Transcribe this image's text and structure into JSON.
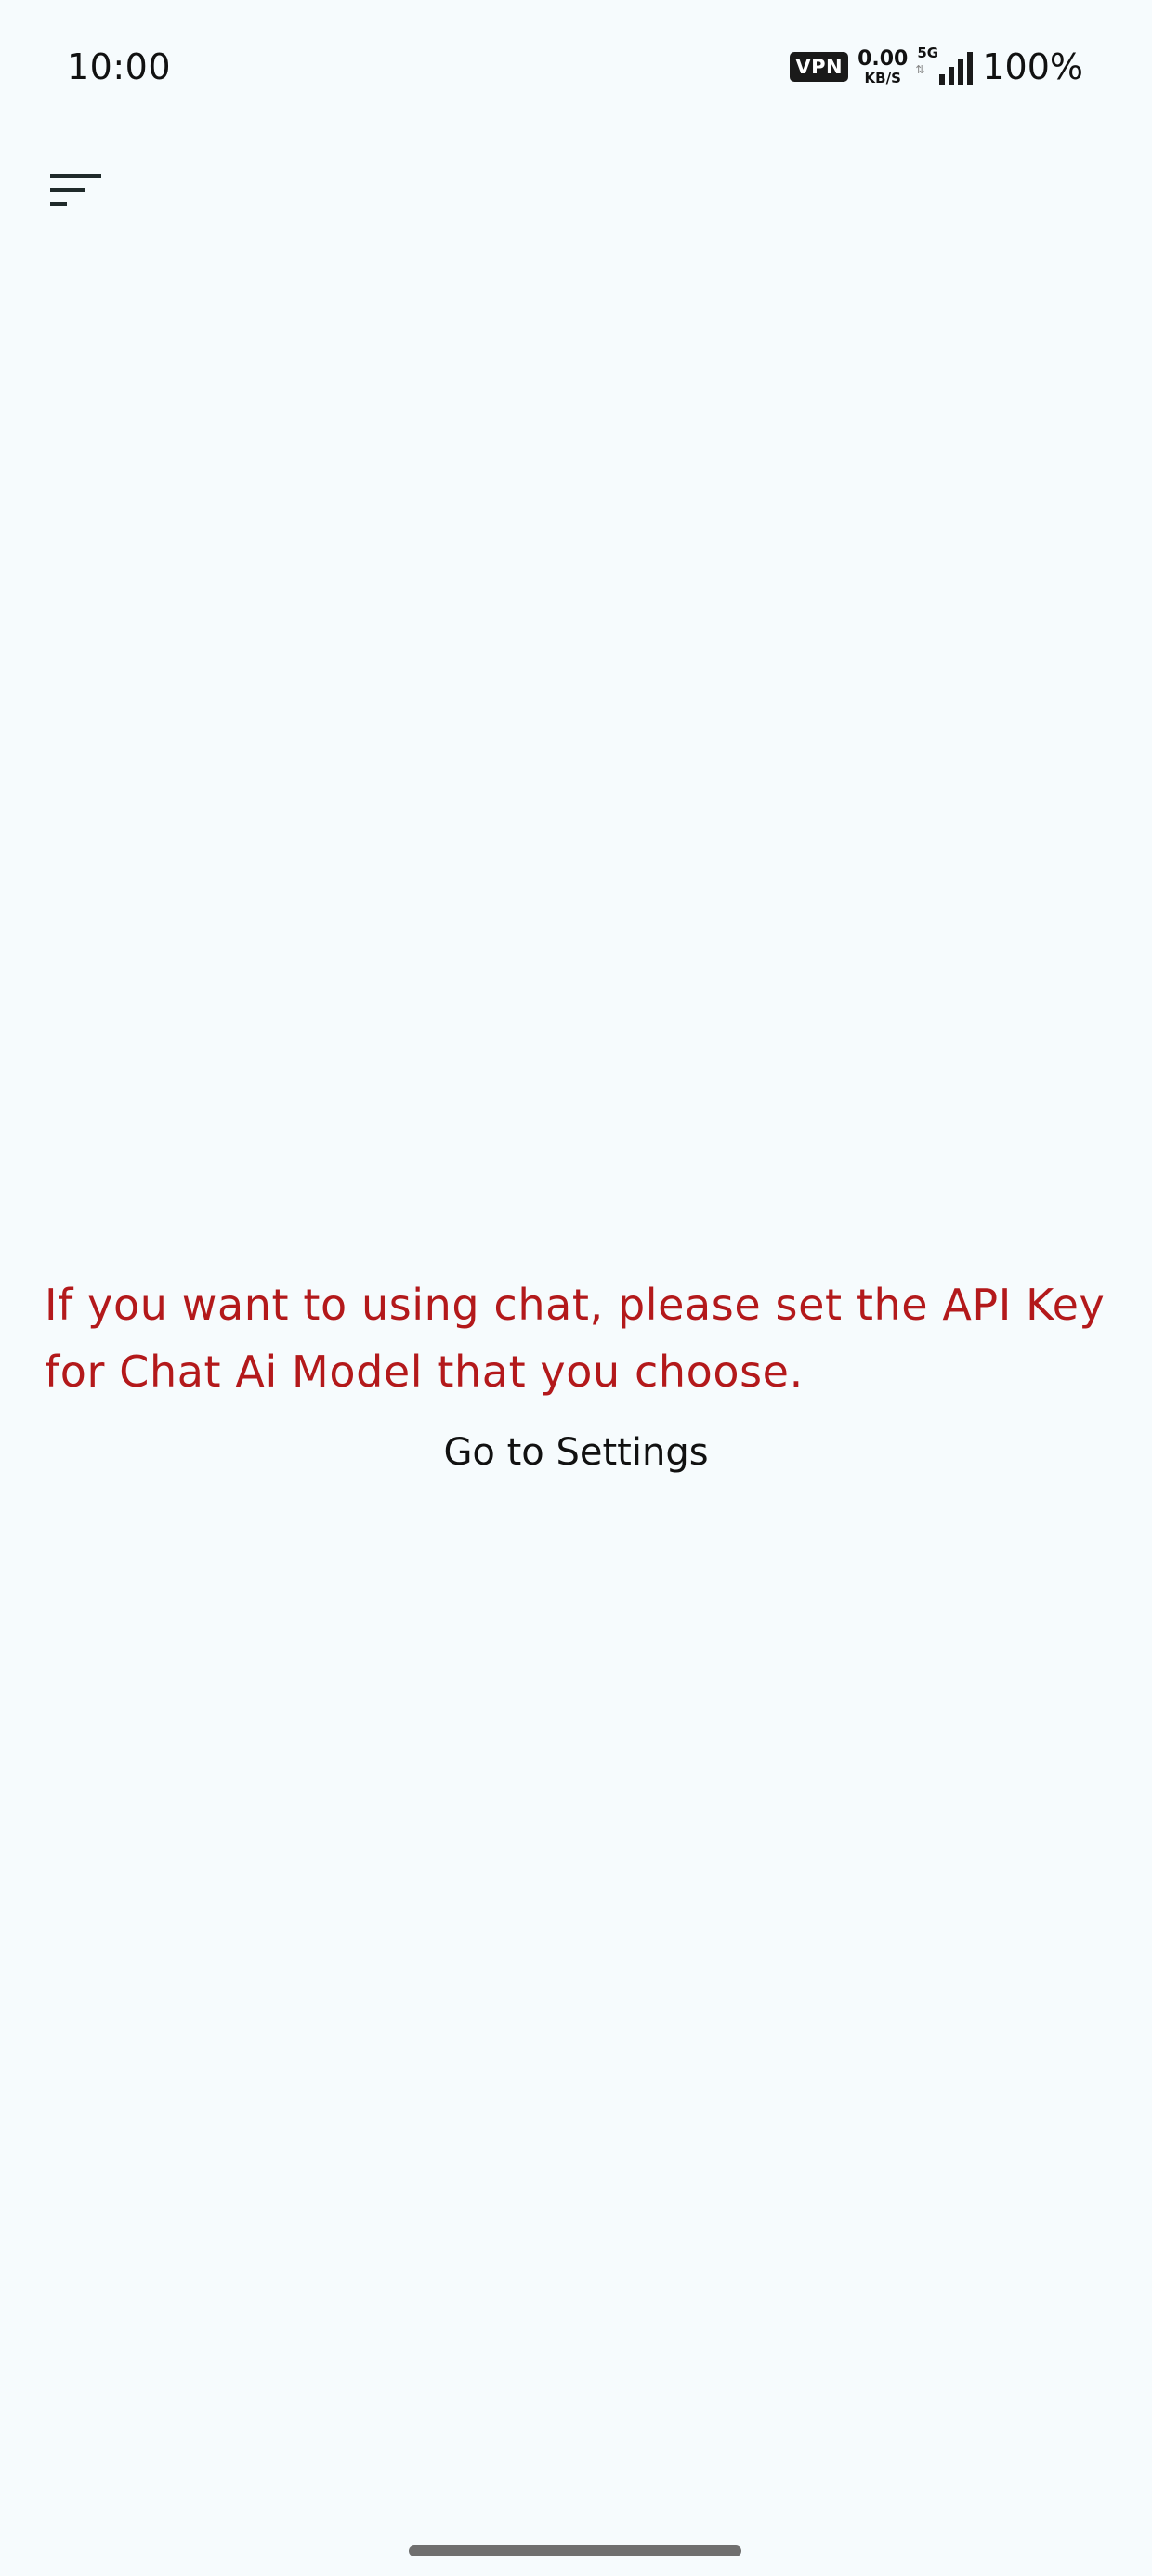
{
  "status_bar": {
    "time": "10:00",
    "vpn_label": "VPN",
    "net_speed_value": "0.00",
    "net_speed_unit": "KB/S",
    "network_type": "5G",
    "battery_text": "100%"
  },
  "toolbar": {
    "menu_icon": "sort-menu-icon"
  },
  "main": {
    "message": "If you want to using chat, please set the API Key for Chat Ai Model that you choose.",
    "settings_button_label": "Go to Settings"
  },
  "colors": {
    "background": "#f6fbfd",
    "error_text": "#b3191b",
    "text": "#111111"
  }
}
